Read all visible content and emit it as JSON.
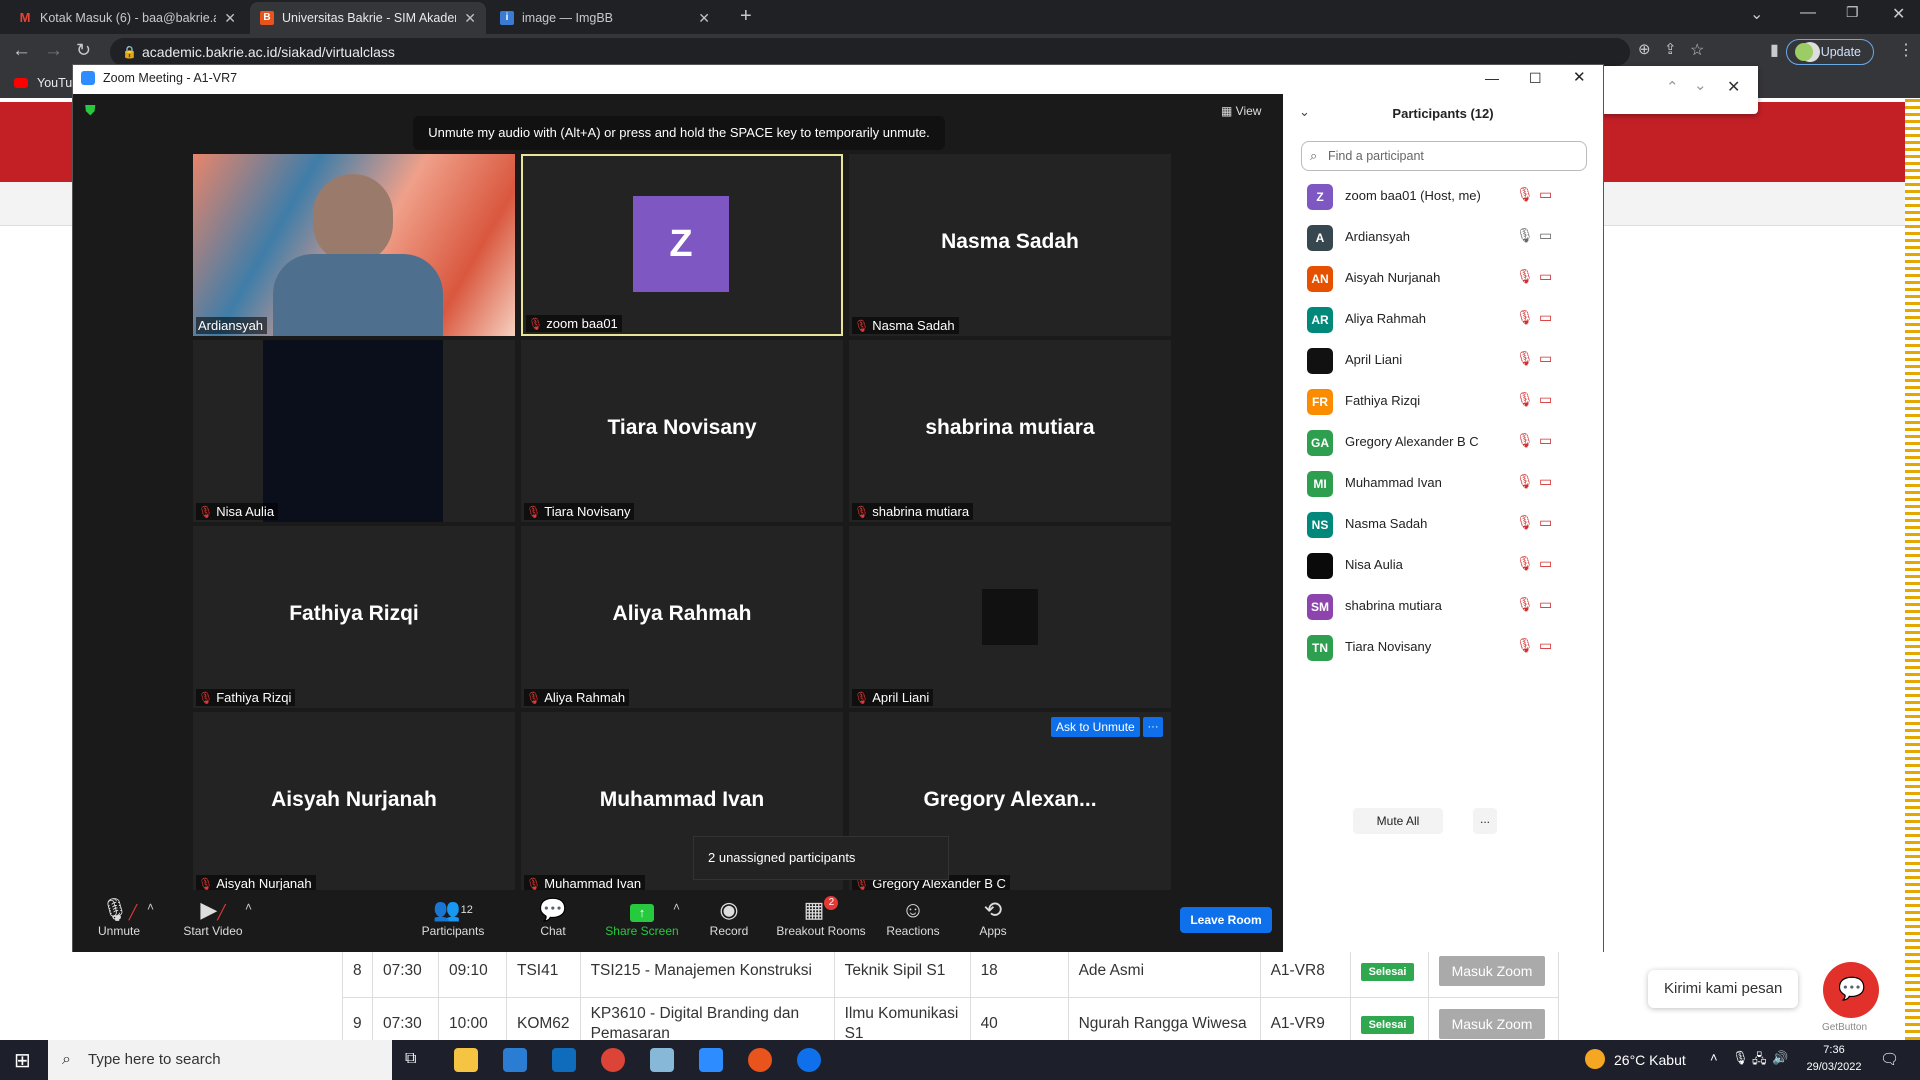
{
  "browser": {
    "tabs": [
      {
        "title": "Kotak Masuk (6) - baa@bakrie.ac.id",
        "favicon": "gmail-icon",
        "color": "#ea4335"
      },
      {
        "title": "Universitas Bakrie - SIM Akademik",
        "favicon": "bakrie-icon",
        "color": "#e8541c"
      },
      {
        "title": "image — ImgBB",
        "favicon": "imgbb-icon",
        "color": "#3a7bd5"
      }
    ],
    "url": "academic.bakrie.ac.id/siakad/virtualclass",
    "update_label": "Update",
    "bookmark": "YouTu"
  },
  "zoom": {
    "window_title": "Zoom Meeting - A1-VR7",
    "view_label": "View",
    "tooltip": "Unmute my audio with (Alt+A) or press and hold the SPACE key to temporarily unmute.",
    "avatar_letter": "Z",
    "ask_unmute": "Ask to Unmute",
    "more": "···",
    "unassigned": "2 unassigned participants",
    "tiles": [
      {
        "name": "Ardiansyah",
        "big": ""
      },
      {
        "name": "zoom baa01",
        "big": ""
      },
      {
        "name": "Nasma Sadah",
        "big": "Nasma Sadah"
      },
      {
        "name": "Nisa Aulia",
        "big": ""
      },
      {
        "name": "Tiara Novisany",
        "big": "Tiara Novisany"
      },
      {
        "name": "shabrina mutiara",
        "big": "shabrina mutiara"
      },
      {
        "name": "Fathiya Rizqi",
        "big": "Fathiya Rizqi"
      },
      {
        "name": "Aliya Rahmah",
        "big": "Aliya Rahmah"
      },
      {
        "name": "April Liani",
        "big": ""
      },
      {
        "name": "Aisyah Nurjanah",
        "big": "Aisyah Nurjanah"
      },
      {
        "name": "Muhammad Ivan",
        "big": "Muhammad Ivan"
      },
      {
        "name": "Gregory Alexander B C",
        "big": "Gregory  Alexan..."
      }
    ],
    "toolbar": {
      "unmute": "Unmute",
      "start_video": "Start Video",
      "participants": "Participants",
      "participants_count": "12",
      "chat": "Chat",
      "share": "Share Screen",
      "record": "Record",
      "breakout": "Breakout Rooms",
      "breakout_badge": "2",
      "reactions": "Reactions",
      "apps": "Apps",
      "leave": "Leave Room"
    },
    "panel": {
      "title": "Participants (12)",
      "search_placeholder": "Find a participant",
      "mute_all": "Mute All",
      "more": "...",
      "participants": [
        {
          "initials": "Z",
          "name": "zoom baa01 (Host, me)",
          "color": "#7e57c2",
          "muted": true
        },
        {
          "initials": "A",
          "name": "Ardiansyah",
          "color": "#37474f",
          "muted": false
        },
        {
          "initials": "AN",
          "name": "Aisyah Nurjanah",
          "color": "#e65100",
          "muted": true
        },
        {
          "initials": "AR",
          "name": "Aliya Rahmah",
          "color": "#00897b",
          "muted": true
        },
        {
          "initials": "",
          "name": "April Liani",
          "color": "#111111",
          "muted": true
        },
        {
          "initials": "FR",
          "name": "Fathiya Rizqi",
          "color": "#fb8c00",
          "muted": true
        },
        {
          "initials": "GA",
          "name": "Gregory Alexander B C",
          "color": "#2e9e4f",
          "muted": true
        },
        {
          "initials": "MI",
          "name": "Muhammad Ivan",
          "color": "#2e9e4f",
          "muted": true
        },
        {
          "initials": "NS",
          "name": "Nasma Sadah",
          "color": "#00897b",
          "muted": true
        },
        {
          "initials": "",
          "name": "Nisa Aulia",
          "color": "#0a0a0a",
          "muted": true
        },
        {
          "initials": "SM",
          "name": "shabrina mutiara",
          "color": "#8e44ad",
          "muted": true
        },
        {
          "initials": "TN",
          "name": "Tiara Novisany",
          "color": "#2e9e4f",
          "muted": true
        }
      ]
    }
  },
  "schedule": {
    "rows": [
      {
        "no": "8",
        "start": "07:30",
        "end": "09:10",
        "room": "TSI41",
        "course": "TSI215 - Manajemen Konstruksi",
        "prodi": "Teknik Sipil S1",
        "count": "18",
        "lecturer": "Ade Asmi",
        "vr": "A1-VR8",
        "status": "Selesai",
        "action": "Masuk Zoom"
      },
      {
        "no": "9",
        "start": "07:30",
        "end": "10:00",
        "room": "KOM62",
        "course": "KP3610 - Digital Branding dan Pemasaran",
        "prodi": "Ilmu Komunikasi S1",
        "count": "40",
        "lecturer": "Ngurah Rangga Wiwesa",
        "vr": "A1-VR9",
        "status": "Selesai",
        "action": "Masuk Zoom"
      }
    ]
  },
  "chat_widget": {
    "message": "Kirimi kami pesan",
    "brand": "GetButton"
  },
  "taskbar": {
    "search_placeholder": "Type here to search",
    "weather": "26°C  Kabut",
    "time": "7:36",
    "date": "29/03/2022"
  }
}
